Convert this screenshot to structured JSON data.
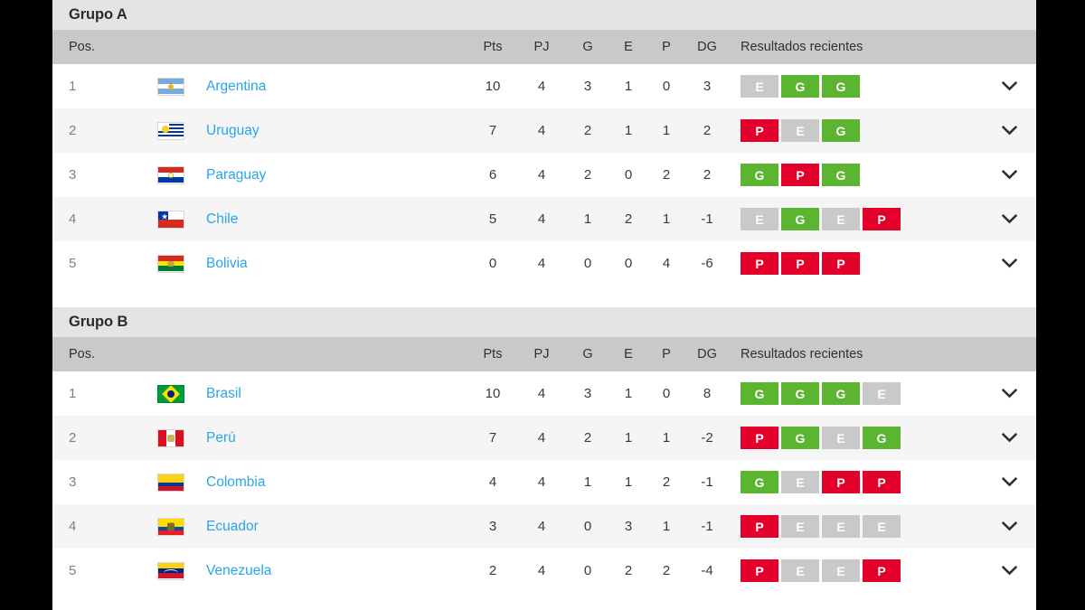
{
  "columns": {
    "pos": "Pos.",
    "pts": "Pts",
    "pj": "PJ",
    "g": "G",
    "e": "E",
    "p": "P",
    "dg": "DG",
    "recent": "Resultados recientes"
  },
  "colors": {
    "win": "#5cb531",
    "loss": "#e3002b",
    "draw": "#c9c9c9",
    "link": "#29a5e8",
    "group_header_bg": "#e4e4e4",
    "table_header_bg": "#c9c9c9",
    "row_alt_bg": "#f5f5f5"
  },
  "icons": {
    "expand": "chevron-down-icon"
  },
  "groups": [
    {
      "title": "Grupo A",
      "rows": [
        {
          "pos": "1",
          "flag": "ar",
          "team": "Argentina",
          "pts": "10",
          "pj": "4",
          "g": "3",
          "e": "1",
          "p": "0",
          "dg": "3",
          "recent": [
            "E",
            "G",
            "G"
          ]
        },
        {
          "pos": "2",
          "flag": "uy",
          "team": "Uruguay",
          "pts": "7",
          "pj": "4",
          "g": "2",
          "e": "1",
          "p": "1",
          "dg": "2",
          "recent": [
            "P",
            "E",
            "G"
          ]
        },
        {
          "pos": "3",
          "flag": "py",
          "team": "Paraguay",
          "pts": "6",
          "pj": "4",
          "g": "2",
          "e": "0",
          "p": "2",
          "dg": "2",
          "recent": [
            "G",
            "P",
            "G"
          ]
        },
        {
          "pos": "4",
          "flag": "cl",
          "team": "Chile",
          "pts": "5",
          "pj": "4",
          "g": "1",
          "e": "2",
          "p": "1",
          "dg": "-1",
          "recent": [
            "E",
            "G",
            "E",
            "P"
          ]
        },
        {
          "pos": "5",
          "flag": "bo",
          "team": "Bolivia",
          "pts": "0",
          "pj": "4",
          "g": "0",
          "e": "0",
          "p": "4",
          "dg": "-6",
          "recent": [
            "P",
            "P",
            "P"
          ]
        }
      ]
    },
    {
      "title": "Grupo B",
      "rows": [
        {
          "pos": "1",
          "flag": "br",
          "team": "Brasil",
          "pts": "10",
          "pj": "4",
          "g": "3",
          "e": "1",
          "p": "0",
          "dg": "8",
          "recent": [
            "G",
            "G",
            "G",
            "E"
          ]
        },
        {
          "pos": "2",
          "flag": "pe",
          "team": "Perú",
          "pts": "7",
          "pj": "4",
          "g": "2",
          "e": "1",
          "p": "1",
          "dg": "-2",
          "recent": [
            "P",
            "G",
            "E",
            "G"
          ]
        },
        {
          "pos": "3",
          "flag": "co",
          "team": "Colombia",
          "pts": "4",
          "pj": "4",
          "g": "1",
          "e": "1",
          "p": "2",
          "dg": "-1",
          "recent": [
            "G",
            "E",
            "P",
            "P"
          ]
        },
        {
          "pos": "4",
          "flag": "ec",
          "team": "Ecuador",
          "pts": "3",
          "pj": "4",
          "g": "0",
          "e": "3",
          "p": "1",
          "dg": "-1",
          "recent": [
            "P",
            "E",
            "E",
            "E"
          ]
        },
        {
          "pos": "5",
          "flag": "ve",
          "team": "Venezuela",
          "pts": "2",
          "pj": "4",
          "g": "0",
          "e": "2",
          "p": "2",
          "dg": "-4",
          "recent": [
            "P",
            "E",
            "E",
            "P"
          ]
        }
      ]
    }
  ]
}
